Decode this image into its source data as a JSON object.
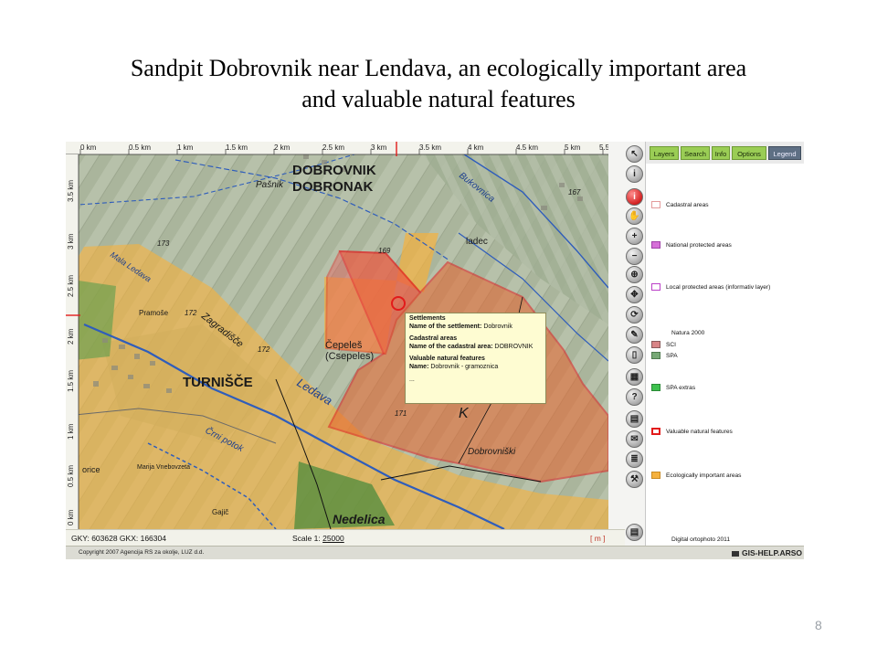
{
  "slide": {
    "title_line1": "Sandpit Dobrovnik near Lendava, an ecologically important area",
    "title_line2": "and valuable natural features",
    "page_number": "8"
  },
  "colors": {
    "natura": "#d98a2a",
    "ecological": "#f5b13d",
    "valuable": "#e21b1b",
    "sci": "#d88486",
    "spa": "#77a976",
    "spa_extras": "#3ec14e",
    "national": "#d66fd8",
    "local": "#bb40c8",
    "cadastral": "#e49c9c"
  },
  "map": {
    "ruler_top": [
      "0 km",
      "0.5 km",
      "1 km",
      "1.5 km",
      "2 km",
      "2.5 km",
      "3 km",
      "3.5 km",
      "4 km",
      "4.5 km",
      "5 km",
      "5.5"
    ],
    "ruler_left": [
      "3.5 km",
      "3 km",
      "2.5 km",
      "2 km",
      "1.5 km",
      "1 km",
      "0.5 km",
      "0 km"
    ],
    "labels": {
      "dobrovnik": "DOBROVNIK",
      "dobronak": "DOBRONAK",
      "turnisce": "TURNIŠČE",
      "nedelica": "Nedelica",
      "pasnik": "Pašnik",
      "bukovnica": "Bukovnica",
      "mala_ledava": "Mala Ledava",
      "zagradisce": "Zagradišče",
      "ledava": "Ledava",
      "crni_potok": "Črni potok",
      "cepeles": "Čepeleš",
      "cepeles_hu": "(Csepeles)",
      "dobrovniski": "Dobrovniški",
      "ladec": "ladec",
      "pramose": "Pramoše",
      "oriče": "orice",
      "marija": "Marija Vnebovzeta",
      "gajic": "Gajič",
      "elev_172_a": "172",
      "elev_172_b": "172",
      "elev_173": "173",
      "elev_169": "169",
      "elev_167": "167",
      "elev_171": "171",
      "k_letter": "K"
    }
  },
  "popup": {
    "settlements_header": "Settlements",
    "settlement_label": "Name of the settlement:",
    "settlement_value": "Dobrovnik",
    "cadastral_header": "Cadastral areas",
    "cadastral_label": "Name of the cadastral area:",
    "cadastral_value": "DOBROVNIK",
    "valuable_header": "Valuable natural features",
    "valuable_label": "Name:",
    "valuable_value": "Dobrovnik - gramoznica",
    "ellipsis": "..."
  },
  "status": {
    "coords": "GKY: 603628 GKX: 166304",
    "scale_label": "Scale 1:",
    "scale_value": "25000",
    "unit": "[ m ]"
  },
  "footer": {
    "copyright": "Copyright 2007 Agencija RS za okolje, LUZ d.d.",
    "brand": "GIS-HELP.ARSO"
  },
  "tabs": [
    {
      "label": "Layers"
    },
    {
      "label": "Search"
    },
    {
      "label": "Info"
    },
    {
      "label": "Options"
    },
    {
      "label": "Legend"
    }
  ],
  "toolbar": [
    {
      "icon": "pointer-icon",
      "glyph": "↖"
    },
    {
      "icon": "info-icon",
      "glyph": "i"
    },
    {
      "icon": "info-active-icon",
      "glyph": "i"
    },
    {
      "icon": "pan-hand-icon",
      "glyph": "✋"
    },
    {
      "icon": "zoom-in-icon",
      "glyph": "+"
    },
    {
      "icon": "zoom-out-icon",
      "glyph": "−"
    },
    {
      "icon": "zoom-extent-icon",
      "glyph": "⊕"
    },
    {
      "icon": "pan-arrows-icon",
      "glyph": "✥"
    },
    {
      "icon": "refresh-icon",
      "glyph": "⟳"
    },
    {
      "icon": "draw-pencil-icon",
      "glyph": "✎"
    },
    {
      "icon": "page-icon",
      "glyph": "▯"
    },
    {
      "icon": "map-icon",
      "glyph": "▦"
    },
    {
      "icon": "help-icon",
      "glyph": "?"
    },
    {
      "icon": "print-icon",
      "glyph": "▤"
    },
    {
      "icon": "mail-icon",
      "glyph": "✉"
    },
    {
      "icon": "list-icon",
      "glyph": "≣"
    },
    {
      "icon": "tools-icon",
      "glyph": "⚒"
    },
    {
      "icon": "layers-icon",
      "glyph": "▤"
    }
  ],
  "legend": {
    "cadastral": "Cadastral areas",
    "national": "National protected areas",
    "local": "Local protected areas (informativ layer)",
    "natura_heading": "Natura 2000",
    "sci": "SCI",
    "spa": "SPA",
    "spa_extras": "SPA extras",
    "valuable": "Valuable natural features",
    "ecological": "Ecologically important areas",
    "orthophoto": "Digital ortophoto 2011"
  }
}
